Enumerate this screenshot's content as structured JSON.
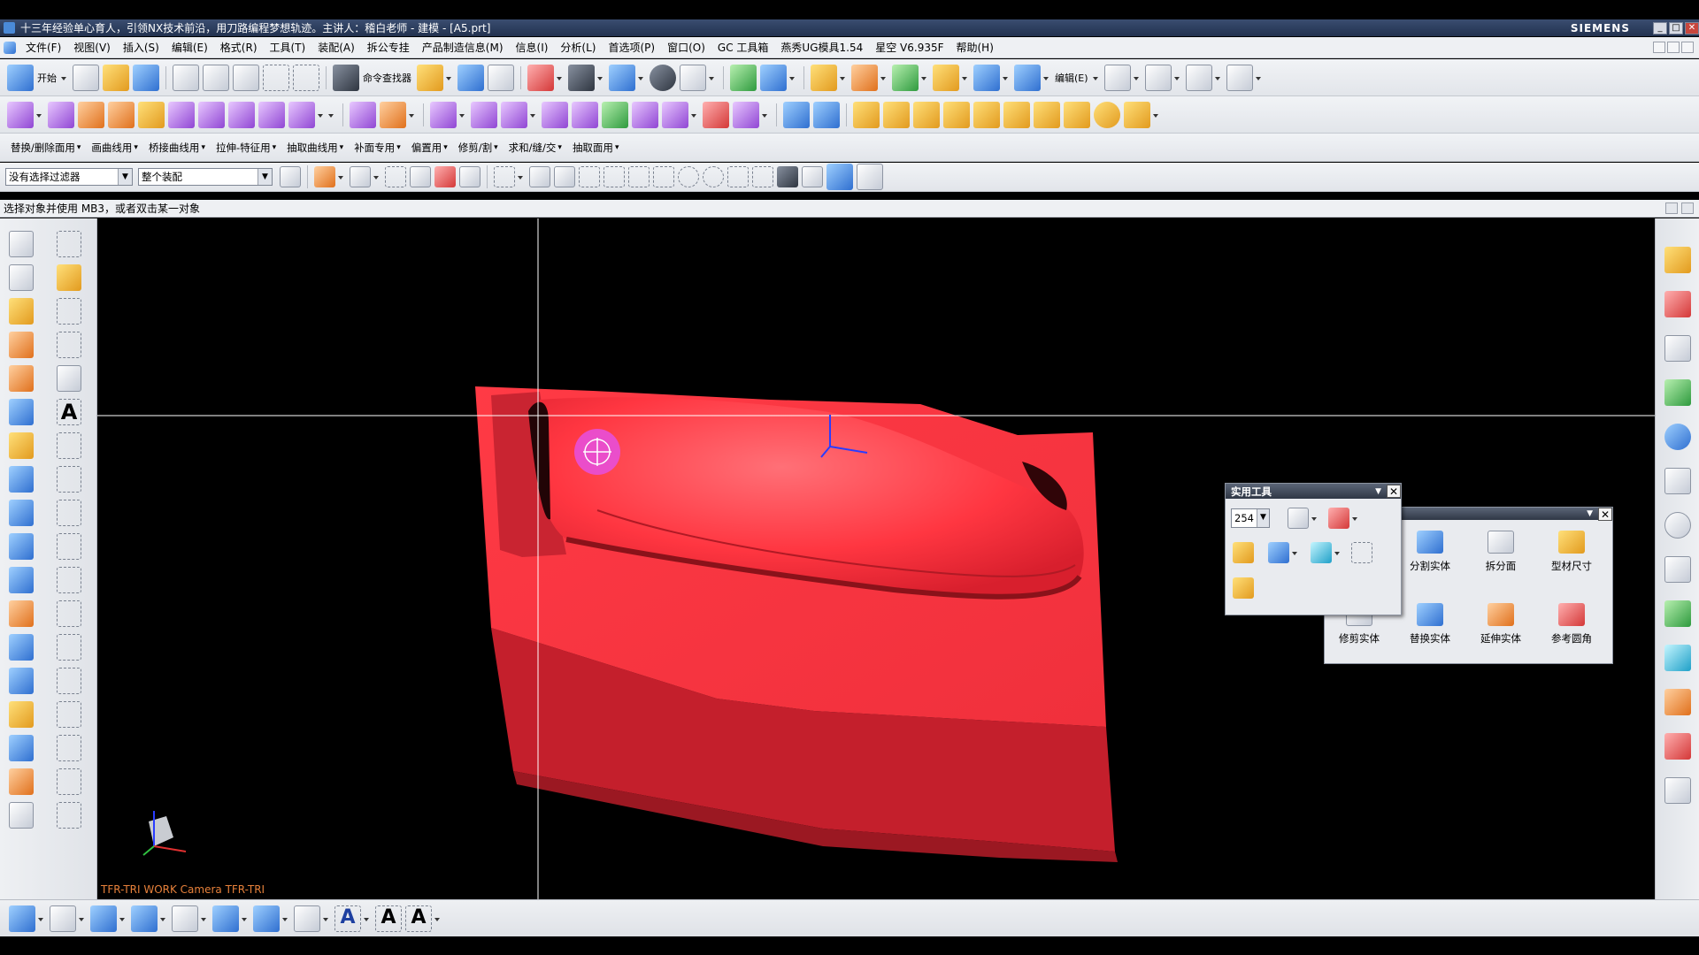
{
  "window": {
    "title": "十三年经验单心育人，引领NX技术前沿，用刀路编程梦想轨迹。主讲人：稽白老师 - 建模 - [A5.prt]",
    "brand": "SIEMENS",
    "controls": [
      "_",
      "□",
      "✕"
    ]
  },
  "menu": {
    "items": [
      "文件(F)",
      "视图(V)",
      "插入(S)",
      "编辑(E)",
      "格式(R)",
      "工具(T)",
      "装配(A)",
      "拆公专挂",
      "产品制造信息(M)",
      "信息(I)",
      "分析(L)",
      "首选项(P)",
      "窗口(O)",
      "GC 工具箱",
      "燕秀UG模具1.54",
      "星空 V6.935F",
      "帮助(H)"
    ]
  },
  "toolbar1": {
    "start_label": "开始",
    "command_finder": "命令查找器",
    "edit_label": "编辑(E)"
  },
  "toolbar3": {
    "menus": [
      "替换/删除面用",
      "画曲线用",
      "桥接曲线用",
      "拉伸-特征用",
      "抽取曲线用",
      "补面专用",
      "偏置用",
      "修剪/割",
      "求和/缝/交",
      "抽取面用"
    ]
  },
  "selection": {
    "filter": "没有选择过滤器",
    "scope": "整个装配"
  },
  "status": {
    "prompt": "选择对象并使用 MB3，或者双击某一对象"
  },
  "viewport": {
    "label": "TFR-TRI WORK Camera TFR-TRI",
    "model_color": "#ff3340",
    "cursor_color": "#e84fd8"
  },
  "utility_panel": {
    "title": "实用工具",
    "layer_value": "254"
  },
  "solid_panel": {
    "buttons": [
      {
        "label": "分割实体",
        "icon": "split-body-icon"
      },
      {
        "label": "拆分面",
        "icon": "divide-face-icon"
      },
      {
        "label": "型材尺寸",
        "icon": "stock-size-icon"
      },
      {
        "label": "修剪实体",
        "icon": "trim-body-icon"
      },
      {
        "label": "替换实体",
        "icon": "replace-body-icon"
      },
      {
        "label": "延伸实体",
        "icon": "extend-body-icon"
      },
      {
        "label": "参考圆角",
        "icon": "reference-blend-icon"
      }
    ]
  }
}
